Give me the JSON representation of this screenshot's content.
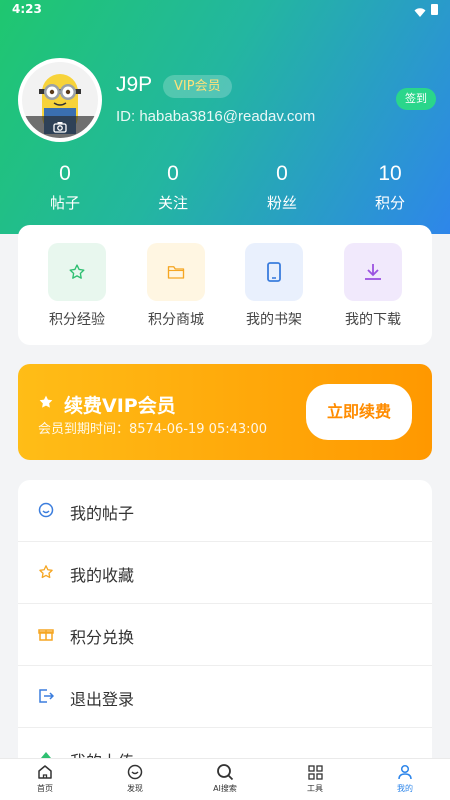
{
  "status_bar": {
    "time": "4:23"
  },
  "profile": {
    "username": "J9P",
    "vip_tag": "VIP会员",
    "user_id": "ID: hababa3816@readav.com",
    "signin_label": "签到"
  },
  "stats": [
    {
      "value": "0",
      "label": "帖子"
    },
    {
      "value": "0",
      "label": "关注"
    },
    {
      "value": "0",
      "label": "粉丝"
    },
    {
      "value": "10",
      "label": "积分"
    }
  ],
  "quick_actions": [
    {
      "label": "积分经验",
      "icon": "star-icon",
      "bg": "#e8f7ee",
      "color": "#2fbf71"
    },
    {
      "label": "积分商城",
      "icon": "folder-icon",
      "bg": "#fff6e2",
      "color": "#f5a623"
    },
    {
      "label": "我的书架",
      "icon": "phone-icon",
      "bg": "#e9f0fd",
      "color": "#3b7ddd"
    },
    {
      "label": "我的下载",
      "icon": "download-icon",
      "bg": "#f1e9fc",
      "color": "#9b51e0"
    }
  ],
  "vip_card": {
    "title": "续费VIP会员",
    "expire_text": "会员到期时间：8574-06-19 05:43:00",
    "button_label": "立即续费"
  },
  "menu": [
    {
      "label": "我的帖子",
      "icon": "smile-icon",
      "color": "#3b7ddd"
    },
    {
      "label": "我的收藏",
      "icon": "star-outline-icon",
      "color": "#f5a623"
    },
    {
      "label": "积分兑换",
      "icon": "gift-icon",
      "color": "#f5a623"
    },
    {
      "label": "退出登录",
      "icon": "logout-icon",
      "color": "#3b7ddd"
    },
    {
      "label": "我的上传",
      "icon": "upload-icon",
      "color": "#2fbf71"
    }
  ],
  "tabbar": [
    {
      "label": "首页",
      "icon": "home-icon"
    },
    {
      "label": "发现",
      "icon": "compass-icon"
    },
    {
      "label": "AI搜索",
      "icon": "search-icon"
    },
    {
      "label": "工具",
      "icon": "grid-icon"
    },
    {
      "label": "我的",
      "icon": "user-icon",
      "active": true
    }
  ],
  "colors": {
    "accent_green": "#1fc76f",
    "accent_blue": "#2e86ea",
    "vip_orange": "#ff9800",
    "vip_gold": "#ffe07a"
  }
}
